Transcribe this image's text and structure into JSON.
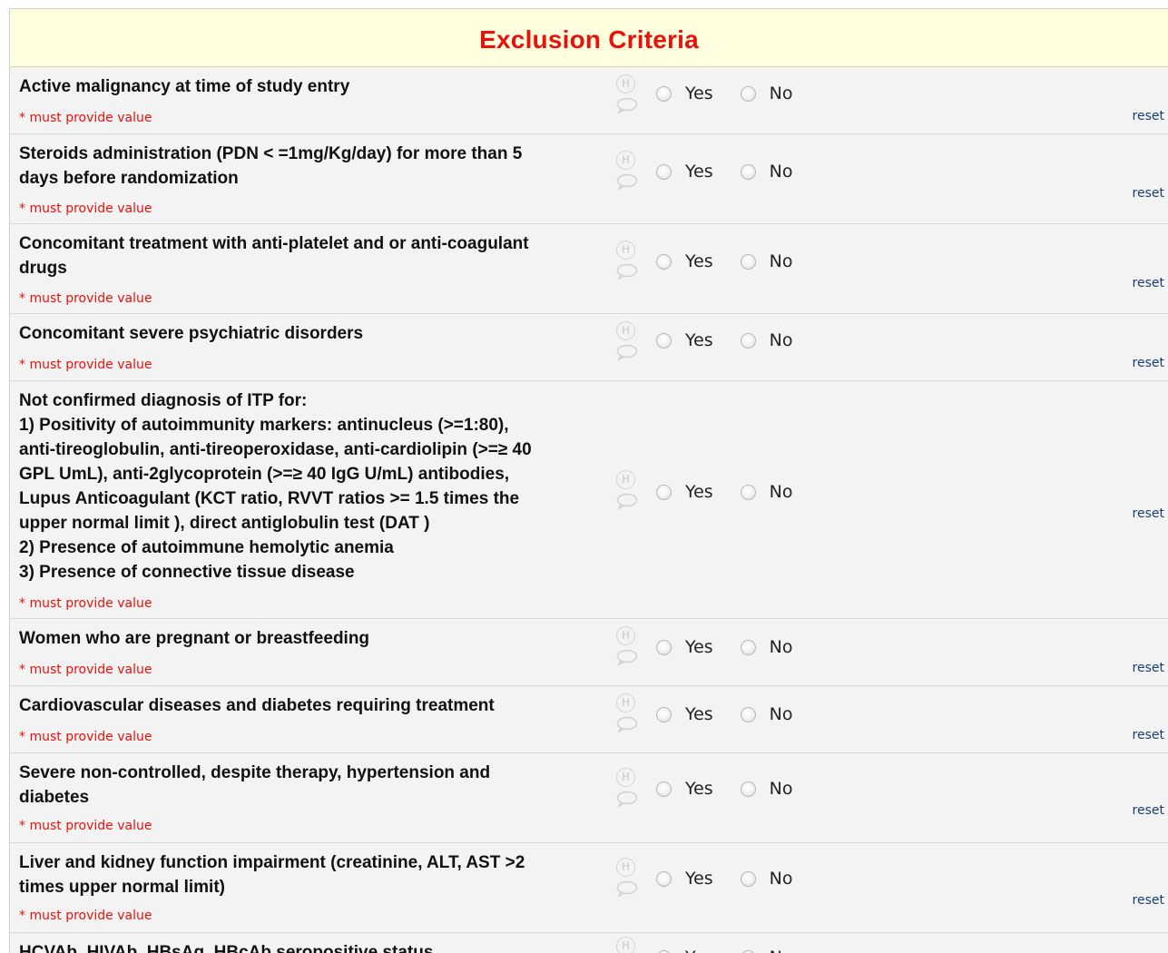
{
  "section": {
    "title": "Exclusion Criteria"
  },
  "labels": {
    "required": "* must provide value",
    "yes": "Yes",
    "no": "No",
    "reset": "reset",
    "history_icon_glyph": "H"
  },
  "colors": {
    "header_bg": "#ffffe0",
    "title": "#e8120c",
    "required": "#e8120c",
    "row_bg": "#f3f3f3",
    "reset_link": "#1a3d6e"
  },
  "icons": {
    "history": "history-icon",
    "comment": "comment-icon"
  },
  "questions": [
    {
      "text": "Active malignancy at time of study entry"
    },
    {
      "text": "Steroids administration (PDN < =1mg/Kg/day) for more than 5\ndays before randomization"
    },
    {
      "text": "Concomitant treatment with anti-platelet and or anti-coagulant\ndrugs"
    },
    {
      "text": "Concomitant severe psychiatric disorders"
    },
    {
      "text": "Not confirmed diagnosis of ITP for:\n1) Positivity of autoimmunity markers: antinucleus (>=1:80),\nanti-tireoglobulin, anti-tireoperoxidase, anti-cardiolipin (>=≥ 40\nGPL UmL), anti-2glycoprotein (>=≥ 40 IgG U/mL) antibodies,\nLupus Anticoagulant (KCT ratio, RVVT ratios >= 1.5 times the\nupper normal limit ), direct antiglobulin test (DAT )\n2) Presence of autoimmune hemolytic anemia\n3) Presence of connective tissue disease"
    },
    {
      "text": "Women who are pregnant or breastfeeding"
    },
    {
      "text": "Cardiovascular diseases and diabetes requiring treatment"
    },
    {
      "text": "Severe non-controlled, despite therapy, hypertension and\ndiabetes"
    },
    {
      "text": "Liver and kidney function impairment (creatinine, ALT, AST >2\ntimes upper normal limit)"
    },
    {
      "text": "HCVAb, HIVAb, HBsAg, HBcAb seropositive status"
    }
  ]
}
